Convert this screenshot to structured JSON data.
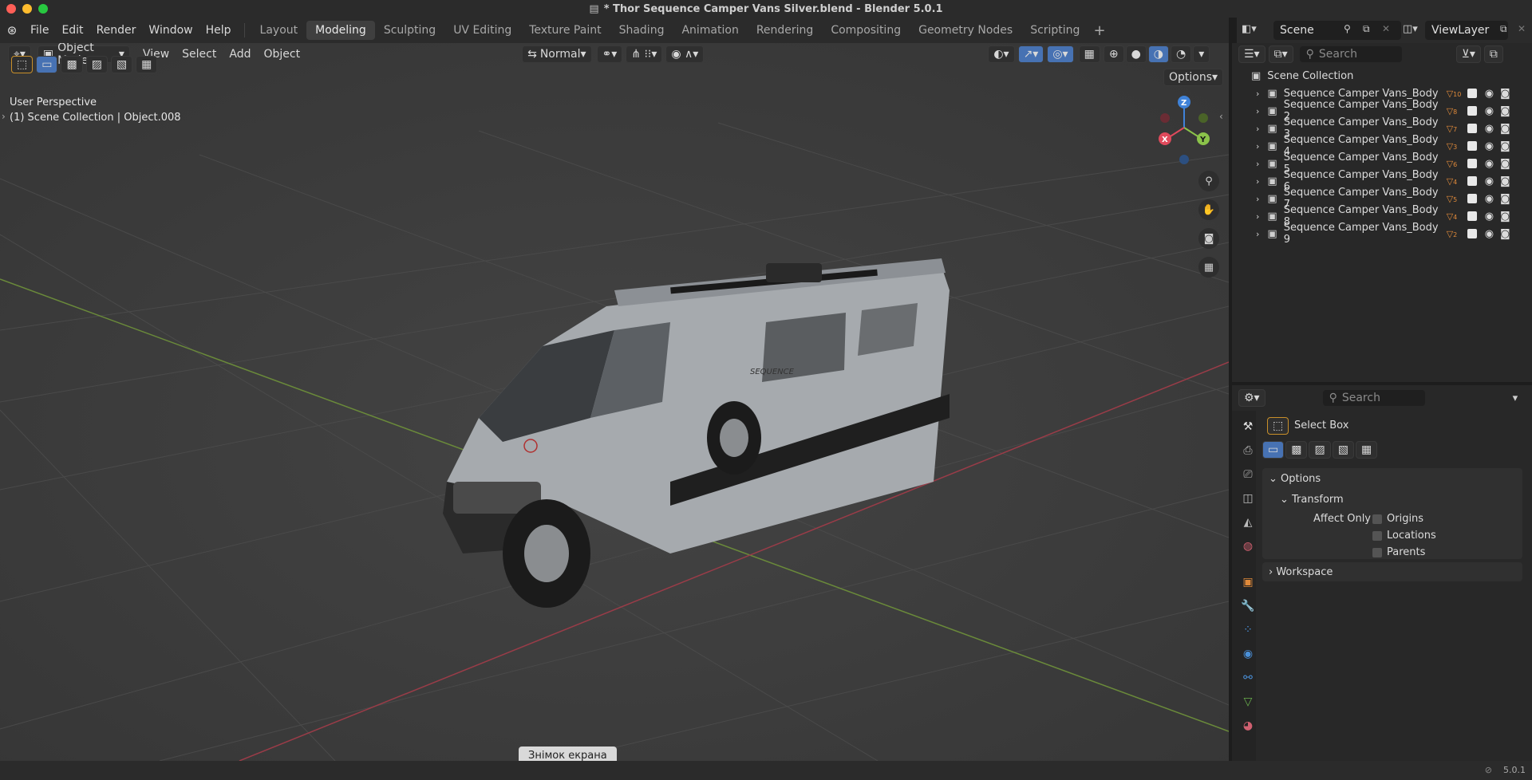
{
  "window": {
    "title": "* Thor Sequence Camper Vans Silver.blend - Blender 5.0.1"
  },
  "menu": [
    "File",
    "Edit",
    "Render",
    "Window",
    "Help"
  ],
  "workspaces": [
    {
      "label": "Layout",
      "active": false
    },
    {
      "label": "Modeling",
      "active": true
    },
    {
      "label": "Sculpting",
      "active": false
    },
    {
      "label": "UV Editing",
      "active": false
    },
    {
      "label": "Texture Paint",
      "active": false
    },
    {
      "label": "Shading",
      "active": false
    },
    {
      "label": "Animation",
      "active": false
    },
    {
      "label": "Rendering",
      "active": false
    },
    {
      "label": "Compositing",
      "active": false
    },
    {
      "label": "Geometry Nodes",
      "active": false
    },
    {
      "label": "Scripting",
      "active": false
    }
  ],
  "scene": {
    "name": "Scene",
    "view_layer": "ViewLayer"
  },
  "viewport": {
    "mode": "Object Mode",
    "menus": [
      "View",
      "Select",
      "Add",
      "Object"
    ],
    "orientation": "Normal",
    "options_label": "Options",
    "perspective": "User Perspective",
    "collection_info": "(1) Scene Collection | Object.008"
  },
  "gizmo": {
    "x": "X",
    "y": "Y",
    "z": "Z"
  },
  "outliner": {
    "search_placeholder": "Search",
    "root": "Scene Collection",
    "items": [
      {
        "label": "Sequence Camper Vans_Body",
        "count": "10"
      },
      {
        "label": "Sequence Camper Vans_Body 2",
        "count": "8"
      },
      {
        "label": "Sequence Camper Vans_Body 3",
        "count": "7"
      },
      {
        "label": "Sequence Camper Vans_Body 4",
        "count": "3"
      },
      {
        "label": "Sequence Camper Vans_Body 5",
        "count": "6"
      },
      {
        "label": "Sequence Camper Vans_Body 6",
        "count": "4"
      },
      {
        "label": "Sequence Camper Vans_Body 7",
        "count": "5"
      },
      {
        "label": "Sequence Camper Vans_Body 8",
        "count": "4"
      },
      {
        "label": "Sequence Camper Vans_Body 9",
        "count": "2"
      }
    ]
  },
  "properties": {
    "search_placeholder": "Search",
    "tool_name": "Select Box",
    "options_label": "Options",
    "transform_label": "Transform",
    "affect_only_label": "Affect Only",
    "checkboxes": [
      "Origins",
      "Locations",
      "Parents"
    ],
    "workspace_label": "Workspace"
  },
  "tooltip": "Знімок екрана",
  "status": {
    "version": "5.0.1"
  },
  "colors": {
    "x_axis": "#e04a5c",
    "y_axis": "#8bc34a",
    "z_axis": "#3f82d8",
    "accent": "#4772b3"
  }
}
